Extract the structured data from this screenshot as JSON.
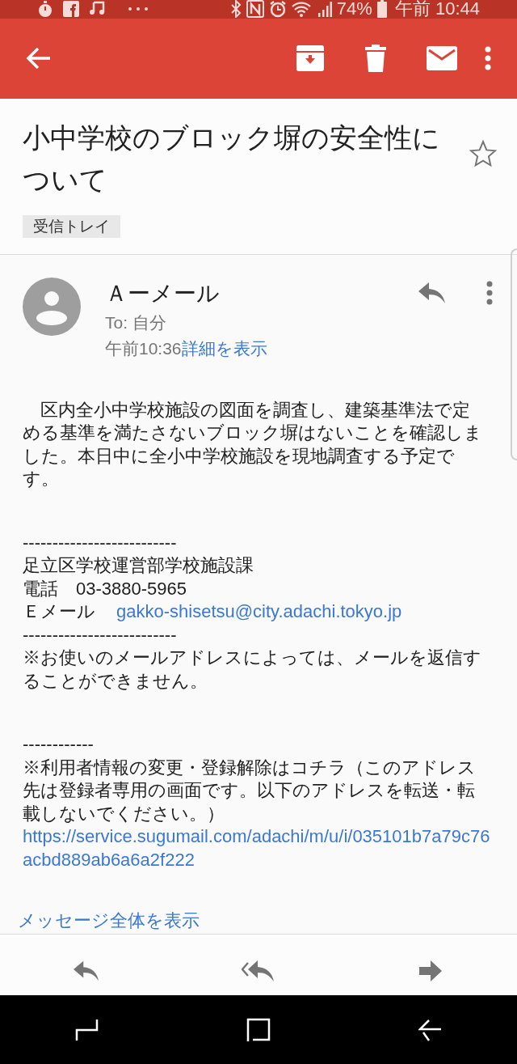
{
  "status_bar": {
    "battery": "74%",
    "time": "午前 10:44"
  },
  "subject": {
    "title": "小中学校のブロック塀の安全性について",
    "label": "受信トレイ",
    "starred": false
  },
  "message": {
    "sender": "Ａーメール",
    "to": "To: 自分",
    "time": "午前10:36",
    "details_link": "詳細を表示",
    "body": [
      {
        "kind": "paragraph",
        "text": "　区内全小中学校施設の図面を調査し、建築基準法で定める基準を満たさないブロック塀はないことを確認しました。本日中に全小中学校施設を現地調査する予定です。"
      },
      {
        "kind": "gap"
      },
      {
        "kind": "line",
        "text": "--------------------------"
      },
      {
        "kind": "line",
        "text": "足立区学校運営部学校施設課"
      },
      {
        "kind": "line",
        "text": "電話　03-3880-5965"
      },
      {
        "kind": "contact",
        "label": "Ｅメール",
        "link": "gakko-shisetsu@city.adachi.tokyo.jp"
      },
      {
        "kind": "line",
        "text": "--------------------------"
      },
      {
        "kind": "paragraph",
        "text": "※お使いのメールアドレスによっては、メールを返信することができません。"
      },
      {
        "kind": "gap"
      },
      {
        "kind": "line",
        "text": "------------"
      },
      {
        "kind": "paragraph",
        "text": "※利用者情報の変更・登録解除はコチラ（このアドレス先は登録者専用の画面です。以下のアドレスを転送・転載しないでください。）"
      },
      {
        "kind": "url",
        "text": "https://service.sugumail.com/adachi/m/u/i/035101b7a79c76acbd889ab6a6a2f222"
      }
    ],
    "show_all": "メッセージ全体を表示"
  }
}
